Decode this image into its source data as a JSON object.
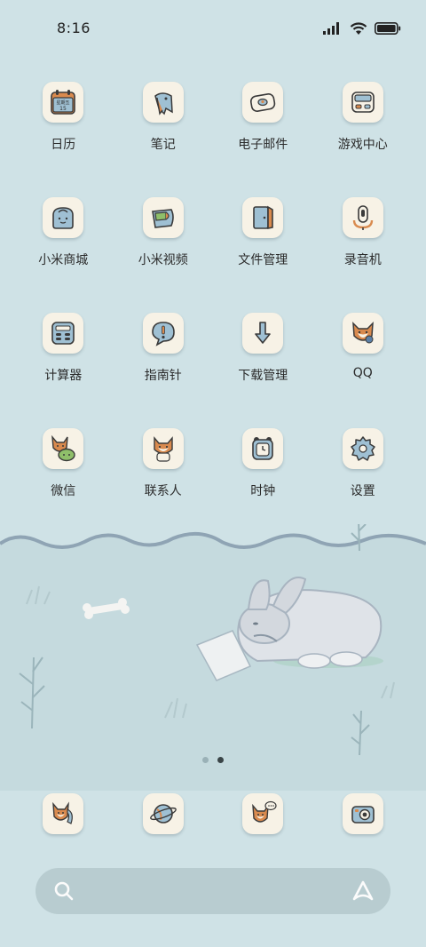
{
  "status_bar": {
    "time": "8:16"
  },
  "apps": [
    {
      "label": "日历",
      "icon": "calendar-icon",
      "day": "星期五",
      "date": "15"
    },
    {
      "label": "笔记",
      "icon": "notes-icon"
    },
    {
      "label": "电子邮件",
      "icon": "email-icon"
    },
    {
      "label": "游戏中心",
      "icon": "game-center-icon"
    },
    {
      "label": "小米商城",
      "icon": "mi-store-icon"
    },
    {
      "label": "小米视频",
      "icon": "mi-video-icon"
    },
    {
      "label": "文件管理",
      "icon": "file-manager-icon"
    },
    {
      "label": "录音机",
      "icon": "recorder-icon"
    },
    {
      "label": "计算器",
      "icon": "calculator-icon"
    },
    {
      "label": "指南针",
      "icon": "compass-icon"
    },
    {
      "label": "下载管理",
      "icon": "download-icon"
    },
    {
      "label": "QQ",
      "icon": "qq-icon"
    },
    {
      "label": "微信",
      "icon": "wechat-icon"
    },
    {
      "label": "联系人",
      "icon": "contacts-icon"
    },
    {
      "label": "时钟",
      "icon": "clock-icon"
    },
    {
      "label": "设置",
      "icon": "settings-icon"
    }
  ],
  "dock": [
    {
      "icon": "phone-icon"
    },
    {
      "icon": "browser-icon"
    },
    {
      "icon": "messages-icon"
    },
    {
      "icon": "camera-icon"
    }
  ],
  "page_indicator": {
    "pages": 2,
    "current": 2
  },
  "colors": {
    "background": "#cfe2e6",
    "icon_tile": "#f7f2e6",
    "accent_blue": "#8fb3c7",
    "accent_orange": "#d98a4e",
    "outline": "#3a3a3a"
  }
}
